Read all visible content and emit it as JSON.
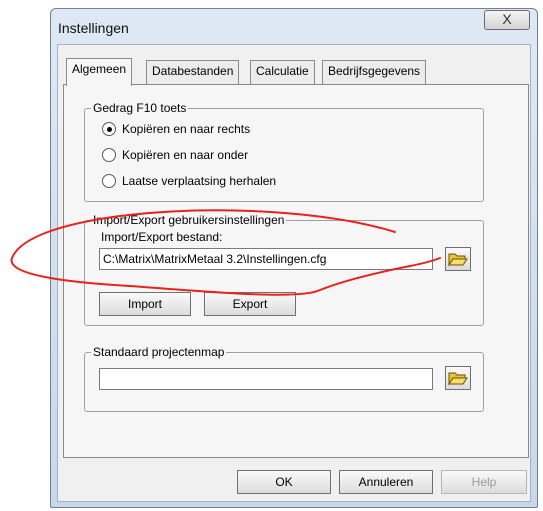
{
  "window": {
    "title": "Instellingen",
    "close_label": "X"
  },
  "tabs": [
    {
      "label": "Algemeen",
      "active": true
    },
    {
      "label": "Databestanden",
      "active": false
    },
    {
      "label": "Calculatie",
      "active": false
    },
    {
      "label": "Bedrijfsgegevens",
      "active": false
    }
  ],
  "f10_group": {
    "label": "Gedrag F10 toets",
    "options": [
      {
        "label": "Kopiëren en naar rechts",
        "selected": true
      },
      {
        "label": "Kopiëren en naar onder",
        "selected": false
      },
      {
        "label": "Laatse verplaatsing herhalen",
        "selected": false
      }
    ]
  },
  "import_group": {
    "label": "Import/Export gebruikersinstellingen",
    "file_label": "Import/Export bestand:",
    "file_value": "C:\\Matrix\\MatrixMetaal 3.2\\Instellingen.cfg",
    "import_label": "Import",
    "export_label": "Export"
  },
  "project_group": {
    "label": "Standaard projectenmap",
    "folder_value": ""
  },
  "buttons": {
    "ok": "OK",
    "cancel": "Annuleren",
    "help": "Help"
  },
  "colors": {
    "annotation": "#e8231e",
    "window_frame": "#c8d7ea",
    "dialog_bg": "#f0f0f0"
  },
  "icons": {
    "browse": "folder-open-icon"
  }
}
